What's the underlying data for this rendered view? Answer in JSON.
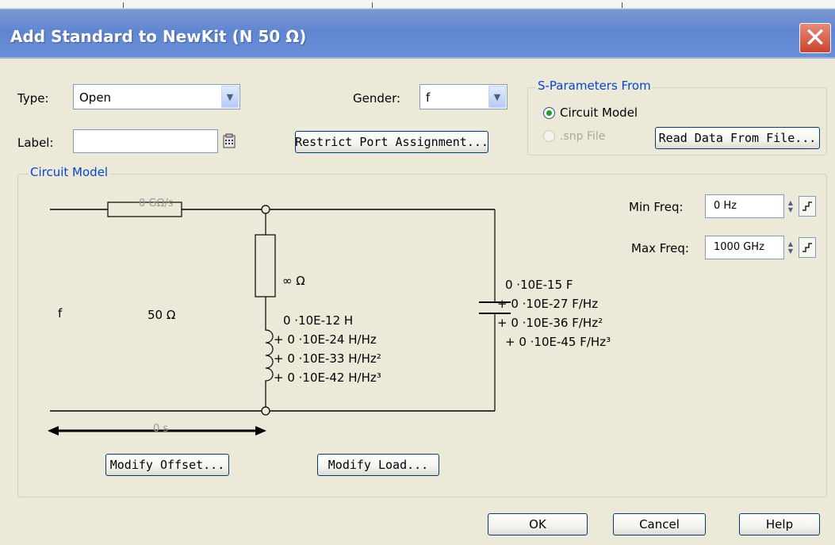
{
  "window": {
    "title": "Add Standard to NewKit (N 50 Ω)",
    "close_glyph": "✕"
  },
  "type_field": {
    "label": "Type:",
    "value": "Open"
  },
  "gender_field": {
    "label": "Gender:",
    "value": "f"
  },
  "label_field": {
    "label": "Label:",
    "value": ""
  },
  "restrict_button": "Restrict Port Assignment...",
  "sparams": {
    "group_label": "S-Parameters From",
    "circuit_model_option": "Circuit Model",
    "snp_file_option": ".snp File",
    "read_button": "Read Data From File..."
  },
  "circuit_model": {
    "group_label": "Circuit Model",
    "min_freq_label": "Min Freq:",
    "min_freq_value": "0 Hz",
    "max_freq_label": "Max Freq:",
    "max_freq_value": "1000 GHz",
    "offset_loss": "0 GΩ/s",
    "offset_gender": "f",
    "offset_z0": "50 Ω",
    "offset_delay": "0 s",
    "resistance": "∞ Ω",
    "inductance": [
      "0 ·10E-12 H",
      "+ 0 ·10E-24 H/Hz",
      "+ 0 ·10E-33 H/Hz²",
      "+ 0 ·10E-42 H/Hz³"
    ],
    "capacitance": [
      "0 ·10E-15 F",
      "+ 0 ·10E-27 F/Hz",
      "+ 0 ·10E-36 F/Hz²",
      "+ 0 ·10E-45 F/Hz³"
    ],
    "modify_offset_button": "Modify Offset...",
    "modify_load_button": "Modify Load..."
  },
  "footer": {
    "ok": "OK",
    "cancel": "Cancel",
    "help": "Help"
  },
  "colors": {
    "titlebar": "#5f86d2",
    "dialog_bg": "#ece9d8",
    "group_label": "#0046d5",
    "close": "#c9432d"
  }
}
